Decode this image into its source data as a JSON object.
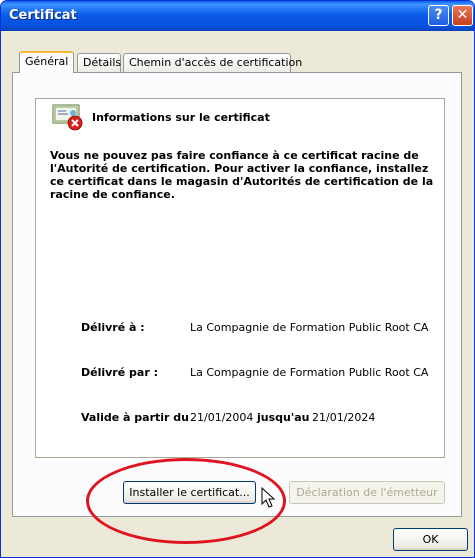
{
  "window": {
    "title": "Certificat"
  },
  "tabs": [
    {
      "label": "Général"
    },
    {
      "label": "Détails"
    },
    {
      "label": "Chemin d'accès de certification"
    }
  ],
  "info": {
    "heading": "Informations sur le certificat",
    "warning": "Vous ne pouvez pas faire confiance à ce certificat racine de l'Autorité de certification. Pour activer la confiance, installez ce certificat dans le magasin d'Autorités de certification de la racine de confiance.",
    "issued_to_label": "Délivré à :",
    "issued_to_value": "La Compagnie de Formation Public Root CA",
    "issued_by_label": "Délivré par :",
    "issued_by_value": "La Compagnie de Formation Public Root CA",
    "valid_from_label": "Valide à partir du",
    "valid_from_value": "21/01/2004",
    "valid_to_label": "jusqu'au",
    "valid_to_value": "21/01/2024"
  },
  "buttons": {
    "install": "Installer le certificat...",
    "issuer_statement": "Déclaration de l'émetteur",
    "ok": "OK"
  },
  "colors": {
    "highlight": "#e0141e",
    "titlebar": "#0a5ce8"
  }
}
